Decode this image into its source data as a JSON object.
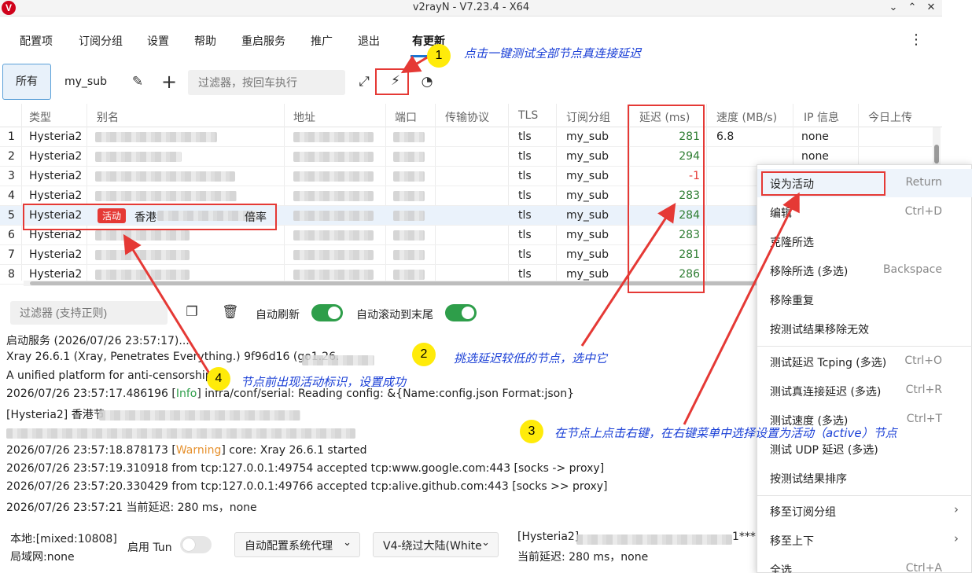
{
  "window": {
    "title": "v2rayN - V7.23.4 - X64",
    "logo": "V"
  },
  "menu": {
    "items": [
      "配置项",
      "订阅分组",
      "设置",
      "帮助",
      "重启服务",
      "推广",
      "退出"
    ],
    "update": "有更新"
  },
  "toolbar": {
    "tab_all": "所有",
    "tab_sub": "my_sub",
    "filter_placeholder": "过滤器，按回车执行"
  },
  "table": {
    "headers": [
      "类型",
      "别名",
      "地址",
      "端口",
      "传输协议",
      "TLS",
      "订阅分组",
      "延迟 (ms)",
      "速度 (MB/s)",
      "IP 信息",
      "今日上传"
    ],
    "rows": [
      {
        "num": "1",
        "type": "Hysteria2",
        "tls": "tls",
        "group": "my_sub",
        "delay": "281",
        "speed": "6.8",
        "ip": "none"
      },
      {
        "num": "2",
        "type": "Hysteria2",
        "tls": "tls",
        "group": "my_sub",
        "delay": "294",
        "speed": "",
        "ip": "none"
      },
      {
        "num": "3",
        "type": "Hysteria2",
        "tls": "tls",
        "group": "my_sub",
        "delay": "-1",
        "speed": "",
        "ip": ""
      },
      {
        "num": "4",
        "type": "Hysteria2",
        "tls": "tls",
        "group": "my_sub",
        "delay": "283",
        "speed": "",
        "ip": ""
      },
      {
        "num": "5",
        "type": "Hysteria2",
        "tls": "tls",
        "group": "my_sub",
        "delay": "284",
        "speed": "",
        "ip": ""
      },
      {
        "num": "6",
        "type": "Hysteria2",
        "tls": "tls",
        "group": "my_sub",
        "delay": "283",
        "speed": "",
        "ip": ""
      },
      {
        "num": "7",
        "type": "Hysteria2",
        "tls": "tls",
        "group": "my_sub",
        "delay": "281",
        "speed": "",
        "ip": ""
      },
      {
        "num": "8",
        "type": "Hysteria2",
        "tls": "tls",
        "group": "my_sub",
        "delay": "286",
        "speed": "",
        "ip": ""
      }
    ],
    "active_badge": "活动",
    "active_alias_prefix": "香港",
    "active_alias_suffix": "倍率"
  },
  "log": {
    "filter_placeholder": "过滤器 (支持正则)",
    "auto_refresh": "自动刷新",
    "auto_scroll": "自动滚动到末尾",
    "lines": {
      "l1": "启动服务 (2026/07/26 23:57:17)...",
      "l2": "Xray 26.6.1 (Xray, Penetrates Everything.) 9f96d16 (go1.26.",
      "l3": "A unified platform for anti-censorship.",
      "l4a": "2026/07/26 23:57:17.486196 [",
      "l4b": "Info",
      "l4c": "] infra/conf/serial: Reading config: &{Name:config.json Format:json}",
      "l5": "[Hysteria2] 香港节",
      "l7a": "2026/07/26 23:57:18.878173 [",
      "l7b": "Warning",
      "l7c": "] core: Xray 26.6.1 started",
      "l8": "2026/07/26 23:57:19.310918 from tcp:127.0.0.1:49754 accepted tcp:www.google.com:443 [socks -> proxy]",
      "l9": "2026/07/26 23:57:20.330429 from tcp:127.0.0.1:49766 accepted tcp:alive.github.com:443 [socks >> proxy]",
      "l10": "2026/07/26 23:57:21 当前延迟: 280 ms，none"
    }
  },
  "status": {
    "local": "本地:[mixed:10808]",
    "lan": "局域网:none",
    "tun_label": "启用 Tun",
    "sysproxy": "自动配置系统代理",
    "routing": "V4-绕过大陆(White",
    "server": "[Hysteria2]",
    "server_suffix": "1***",
    "latency": "当前延迟: 280 ms，none"
  },
  "context_menu": {
    "items": [
      {
        "label": "设为活动",
        "key": "Return"
      },
      {
        "label": "编辑",
        "key": "Ctrl+D"
      },
      {
        "label": "克隆所选",
        "key": ""
      },
      {
        "label": "移除所选 (多选)",
        "key": "Backspace"
      },
      {
        "label": "移除重复",
        "key": ""
      },
      {
        "label": "按测试结果移除无效",
        "key": ""
      },
      {
        "label": "测试延迟 Tcping (多选)",
        "key": "Ctrl+O"
      },
      {
        "label": "测试真连接延迟 (多选)",
        "key": "Ctrl+R"
      },
      {
        "label": "测试速度 (多选)",
        "key": "Ctrl+T"
      },
      {
        "label": "测试 UDP 延迟 (多选)",
        "key": ""
      },
      {
        "label": "按测试结果排序",
        "key": ""
      },
      {
        "label": "移至订阅分组",
        "key": ""
      },
      {
        "label": "移至上下",
        "key": ""
      },
      {
        "label": "全选",
        "key": "Ctrl+A"
      }
    ]
  },
  "annotations": {
    "n1": "1",
    "t1": "点击一键测试全部节点真连接延迟",
    "n2": "2",
    "t2": "挑选延迟较低的节点，选中它",
    "n3": "3",
    "t3": "在节点上点击右键，在右键菜单中选择设置为活动（active）节点",
    "n4": "4",
    "t4": "节点前出现活动标识，设置成功"
  },
  "colors": {
    "accent": "#1976d2",
    "good_delay": "#2e7d32",
    "bad_delay": "#e53935",
    "annotation": "#e53935",
    "note": "#1a3fd6"
  }
}
